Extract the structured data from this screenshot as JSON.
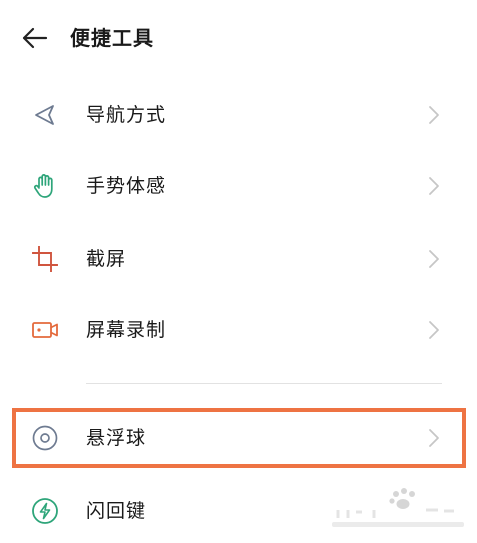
{
  "header": {
    "title": "便捷工具",
    "back_icon": "arrow-left-icon"
  },
  "items": [
    {
      "label": "导航方式",
      "icon": "navigation-triangle-icon",
      "icon_color": "#6e7b91"
    },
    {
      "label": "手势体感",
      "icon": "hand-gesture-icon",
      "icon_color": "#2ea57a"
    },
    {
      "label": "截屏",
      "icon": "crop-screenshot-icon",
      "icon_color": "#d0553f"
    },
    {
      "label": "屏幕录制",
      "icon": "video-record-icon",
      "icon_color": "#e46a3c"
    },
    {
      "label": "悬浮球",
      "icon": "floating-ball-icon",
      "icon_color": "#6e7b91",
      "highlighted": true
    },
    {
      "label": "闪回键",
      "icon": "flashback-lightning-icon",
      "icon_color": "#2ea57a"
    }
  ],
  "colors": {
    "highlight_border": "#ee7343",
    "chevron": "#c6c6c6",
    "divider": "#e2e2e2"
  }
}
